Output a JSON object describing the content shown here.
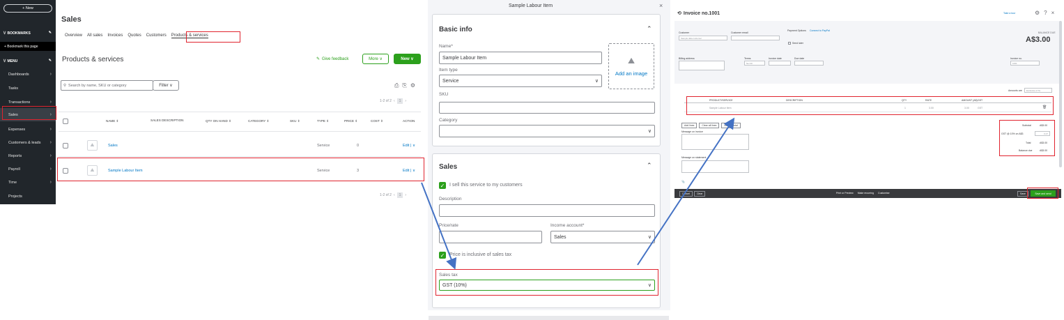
{
  "sidebar": {
    "new_label": "+ New",
    "bookmarks_label": "BOOKMARKS",
    "bookmark_this_page": "+ Bookmark this page",
    "menu_label": "MENU",
    "items": [
      {
        "label": "Dashboards"
      },
      {
        "label": "Tasks"
      },
      {
        "label": "Transactions"
      },
      {
        "label": "Sales"
      },
      {
        "label": "Expenses"
      },
      {
        "label": "Customers & leads"
      },
      {
        "label": "Reports"
      },
      {
        "label": "Payroll"
      },
      {
        "label": "Time"
      },
      {
        "label": "Projects"
      }
    ]
  },
  "products": {
    "page_title": "Sales",
    "tabs": [
      "Overview",
      "All sales",
      "Invoices",
      "Quotes",
      "Customers",
      "Products & services"
    ],
    "section_title": "Products & services",
    "give_feedback": "Give feedback",
    "more_label": "More ∨",
    "new_label": "New ∨",
    "search_placeholder": "Search by name, SKU or category",
    "filter_label": "Filter ∨",
    "pagination": "1-2 of 2",
    "page_number": "1",
    "columns": [
      "NAME ⇕",
      "SALES DESCRIPTION",
      "QTY ON HAND ⇕",
      "CATEGORY ⇕",
      "SKU ⇕",
      "TYPE ⇕",
      "PRICE ⇕",
      "COST ⇕",
      "ACTION"
    ],
    "rows": [
      {
        "name": "Sales",
        "type": "Service",
        "price": "0",
        "action": "Edit | ∨"
      },
      {
        "name": "Sample Labour Item",
        "type": "Service",
        "price": "3",
        "action": "Edit | ∨"
      }
    ]
  },
  "modal": {
    "title": "Sample Labour Item",
    "close": "×",
    "basic_info": "Basic info",
    "name_label": "Name*",
    "name_value": "Sample Labour Item",
    "item_type_label": "Item type",
    "item_type_value": "Service",
    "add_image": "Add an image",
    "sku_label": "SKU",
    "category_label": "Category",
    "sales_title": "Sales",
    "sell_checkbox": "I sell this service to my customers",
    "description_label": "Description",
    "price_label": "Price/rate",
    "income_label": "Income account*",
    "income_value": "Sales",
    "inclusive_label": "Price is inclusive of sales tax",
    "sales_tax_label": "Sales tax",
    "sales_tax_value": "GST (10%)"
  },
  "invoice": {
    "title": "Invoice no.1001",
    "take_tour": "Take a tour",
    "customer_label": "Customer",
    "customer_value": "Sample data customer",
    "email_label": "Customer email",
    "payment_options": "Payment Options",
    "connect_paypal": "Connect to PayPal",
    "send_later": "Send later",
    "balance_label": "BALANCE DUE",
    "balance_value": "A$3.00",
    "billing_label": "Billing address",
    "terms_label": "Terms",
    "terms_value": "Net 30",
    "invoice_date_label": "Invoice date",
    "due_date_label": "Due date",
    "invoice_no_label": "Invoice no.",
    "invoice_no_value": "1001",
    "amounts_label": "Amounts are",
    "amounts_value": "Exclusive of Ta",
    "col_product": "PRODUCT/SERVICE",
    "col_description": "DESCRIPTION",
    "col_qty": "QTY",
    "col_rate": "RATE",
    "col_amount": "AMOUNT (A$)",
    "col_gst": "GST",
    "line_item": "Sample Labour Item",
    "line_qty": "1",
    "line_rate": "3.00",
    "line_amount": "3.00",
    "line_gst": "GST",
    "add_lines": "Add lines",
    "clear_lines": "Clear all lines",
    "add_subtotal": "Add subtotal",
    "message_invoice": "Message on invoice",
    "message_statement": "Message on statement",
    "subtotal_label": "Subtotal",
    "subtotal_value": "A$3.00",
    "gst_label": "GST @ 10% on A$3",
    "gst_value": "0.27",
    "total_label": "Total",
    "total_value": "A$3.00",
    "balance_due_label": "Balance due",
    "balance_due_value": "A$3.00",
    "cancel": "Cancel",
    "clear": "Clear",
    "print": "Print or Preview",
    "recurring": "Make recurring",
    "customise": "Customise",
    "save": "Save",
    "save_send": "Save and send"
  }
}
